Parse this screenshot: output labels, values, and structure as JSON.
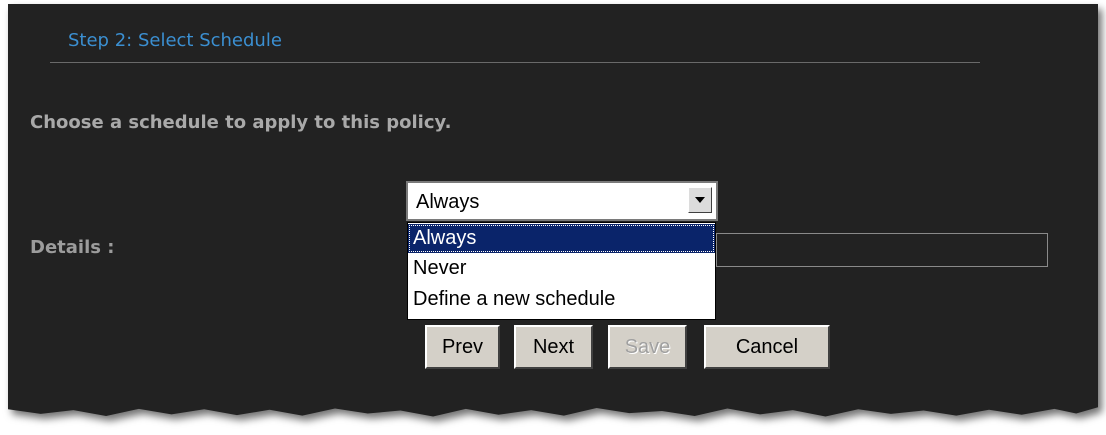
{
  "step": {
    "title": "Step 2: Select Schedule"
  },
  "instruction": "Choose a schedule to apply to this policy.",
  "schedule_select": {
    "selected_value": "Always",
    "options": [
      "Always",
      "Never",
      "Define a new schedule"
    ],
    "highlighted_option": "Always"
  },
  "details": {
    "label": "Details :",
    "value": ""
  },
  "buttons": {
    "prev": "Prev",
    "next": "Next",
    "save": "Save",
    "cancel": "Cancel"
  },
  "colors": {
    "panel_background": "#222222",
    "title_blue": "#3b8fd1",
    "label_gray": "#a9a9a9",
    "selection_highlight": "#0a246a"
  }
}
